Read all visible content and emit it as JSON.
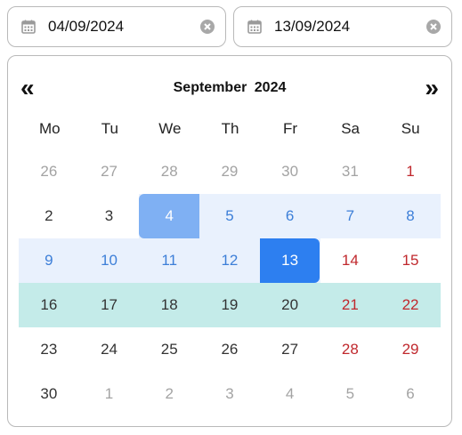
{
  "start_field": {
    "value": "04/09/2024",
    "icon": "calendar-icon",
    "clear_icon": "clear-icon"
  },
  "end_field": {
    "value": "13/09/2024",
    "icon": "calendar-icon",
    "clear_icon": "clear-icon"
  },
  "calendar": {
    "prev": "«",
    "next": "»",
    "month": "September",
    "year": "2024",
    "weekdays": [
      "Mo",
      "Tu",
      "We",
      "Th",
      "Fr",
      "Sa",
      "Su"
    ],
    "weeks": [
      [
        {
          "d": "26",
          "t": "other"
        },
        {
          "d": "27",
          "t": "other"
        },
        {
          "d": "28",
          "t": "other"
        },
        {
          "d": "29",
          "t": "other"
        },
        {
          "d": "30",
          "t": "other"
        },
        {
          "d": "31",
          "t": "other"
        },
        {
          "d": "1",
          "t": "weekend"
        }
      ],
      [
        {
          "d": "2",
          "t": "weekday"
        },
        {
          "d": "3",
          "t": "weekday"
        },
        {
          "d": "4",
          "t": "start-sel"
        },
        {
          "d": "5",
          "t": "in-range"
        },
        {
          "d": "6",
          "t": "in-range"
        },
        {
          "d": "7",
          "t": "in-range"
        },
        {
          "d": "8",
          "t": "in-range"
        }
      ],
      [
        {
          "d": "9",
          "t": "in-range"
        },
        {
          "d": "10",
          "t": "in-range"
        },
        {
          "d": "11",
          "t": "in-range"
        },
        {
          "d": "12",
          "t": "in-range"
        },
        {
          "d": "13",
          "t": "end-sel"
        },
        {
          "d": "14",
          "t": "weekend"
        },
        {
          "d": "15",
          "t": "weekend"
        }
      ],
      [
        {
          "d": "16",
          "t": "weekday"
        },
        {
          "d": "17",
          "t": "weekday"
        },
        {
          "d": "18",
          "t": "weekday"
        },
        {
          "d": "19",
          "t": "weekday"
        },
        {
          "d": "20",
          "t": "weekday"
        },
        {
          "d": "21",
          "t": "weekend"
        },
        {
          "d": "22",
          "t": "weekend"
        }
      ],
      [
        {
          "d": "23",
          "t": "weekday"
        },
        {
          "d": "24",
          "t": "weekday"
        },
        {
          "d": "25",
          "t": "weekday"
        },
        {
          "d": "26",
          "t": "weekday"
        },
        {
          "d": "27",
          "t": "weekday"
        },
        {
          "d": "28",
          "t": "weekend"
        },
        {
          "d": "29",
          "t": "weekend"
        }
      ],
      [
        {
          "d": "30",
          "t": "weekday"
        },
        {
          "d": "1",
          "t": "other"
        },
        {
          "d": "2",
          "t": "other"
        },
        {
          "d": "3",
          "t": "other"
        },
        {
          "d": "4",
          "t": "other"
        },
        {
          "d": "5",
          "t": "other"
        },
        {
          "d": "6",
          "t": "other"
        }
      ]
    ],
    "highlighted_week": 3,
    "colors": {
      "range_bg": "#e9f1fd",
      "start_bg": "#7fb0f3",
      "end_bg": "#2d7ff0",
      "week_highlight_bg": "#c4ebe9",
      "weekend_text": "#c0282d",
      "range_text": "#3d7fd8",
      "other_month_text": "#a3a3a3"
    }
  }
}
